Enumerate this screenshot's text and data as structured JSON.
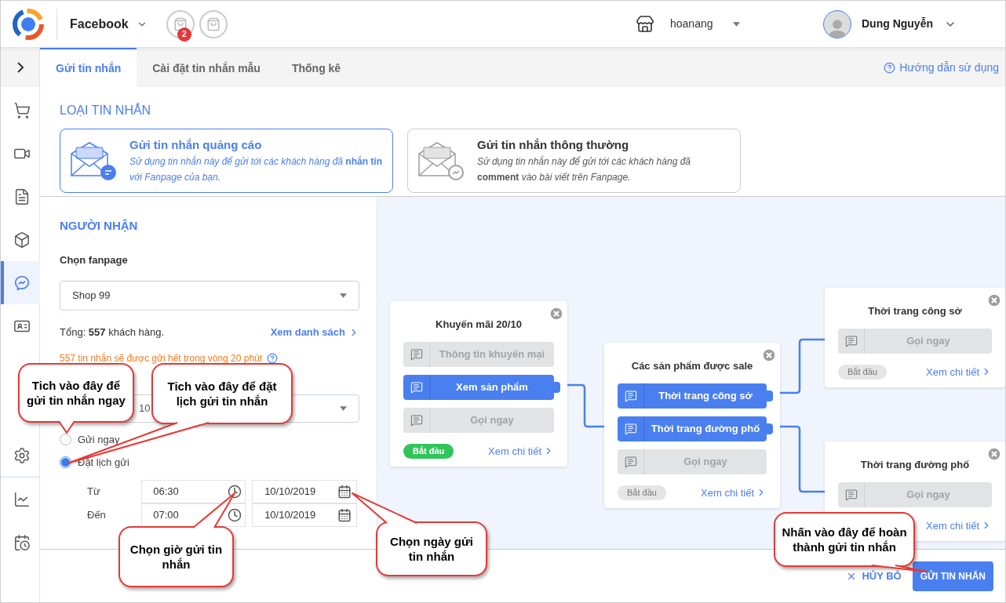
{
  "header": {
    "channel": "Facebook",
    "notification_count": "2",
    "store": "hoanang",
    "user": "Dung Nguyễn"
  },
  "sidebar": {
    "items": [
      {
        "selected": false
      },
      {
        "selected": false
      },
      {
        "selected": false
      },
      {
        "selected": false
      },
      {
        "selected": true
      },
      {
        "selected": false
      },
      {
        "selected": false
      },
      {
        "selected": false
      },
      {
        "selected": false
      }
    ]
  },
  "tabs": [
    {
      "label": "Gửi tin nhắn",
      "selected": true
    },
    {
      "label": "Cài đặt tin nhắn mẫu",
      "selected": false
    },
    {
      "label": "Thống kê",
      "selected": false
    }
  ],
  "help_link": "Hướng dẫn sử dụng",
  "message_type": {
    "heading": "LOẠI TIN NHẮN",
    "options": [
      {
        "title": "Gửi tin nhắn quảng cáo",
        "description": "*Sử dụng tin nhắn này để gửi tới các khách hàng đã* **nhắn tin** *với Fanpage của bạn.*",
        "selected": true
      },
      {
        "title": "Gửi tin nhắn thông thường",
        "description": "*Sử dụng tin nhắn này để gửi tới các khách hàng đã* **comment** *vào bài viết trên Fanpage.*",
        "selected": false
      }
    ]
  },
  "recipient": {
    "heading": "NGƯỜI NHẬN",
    "fanpage_label": "Chọn fanpage",
    "fanpage_value": "Shop 99",
    "total": "Tổng: **557** khách hàng.",
    "list_link": "Xem danh sách",
    "warning": "557 tin nhắn sẽ được gửi hết trong vòng 20 phút",
    "template_value": "10",
    "send_modes": [
      {
        "label": "Gửi ngay",
        "selected": false
      },
      {
        "label": "Đặt lịch gửi",
        "selected": true
      }
    ],
    "schedule": [
      {
        "label": "Từ",
        "time": "06:30",
        "date": "10/10/2019"
      },
      {
        "label": "Đến",
        "time": "07:00",
        "date": "10/10/2019"
      }
    ]
  },
  "flow_nodes": [
    {
      "title": "Khuyến mãi 20/10",
      "buttons": [
        {
          "label": "Thông tin khuyến mại",
          "active": false
        },
        {
          "label": "Xem sản phẩm",
          "active": true
        },
        {
          "label": "Gọi ngay",
          "active": false
        }
      ],
      "status": {
        "label": "Bắt đầu",
        "active": true
      },
      "link": "Xem chi tiết"
    },
    {
      "title": "Các sản phẩm được sale",
      "buttons": [
        {
          "label": "Thời trang công sở",
          "active": true
        },
        {
          "label": "Thời trang đường phố",
          "active": true
        },
        {
          "label": "Gọi ngay",
          "active": false
        }
      ],
      "status": {
        "label": "Bắt đầu",
        "active": false
      },
      "link": "Xem chi tiết"
    },
    {
      "title": "Thời trang công sở",
      "buttons": [
        {
          "label": "Gọi ngay",
          "active": false
        }
      ],
      "status": {
        "label": "Bắt đầu",
        "active": false
      },
      "link": "Xem chi tiết"
    },
    {
      "title": "Thời trang đường phố",
      "buttons": [
        {
          "label": "Gọi ngay",
          "active": false
        }
      ],
      "link": "Xem chi tiết"
    }
  ],
  "footer": {
    "cancel": "HỦY BỎ",
    "submit": "GỬI TIN NHẮN"
  },
  "callouts": [
    "Tich vào đây để gửi tin nhắn ngay",
    "Tich vào đây để đặt lịch gửi tin nhắn",
    "Chọn giờ gửi tin nhắn",
    "Chọn ngày gửi tin nhắn",
    "Nhấn vào đây để hoàn thành gửi tin nhắn"
  ]
}
